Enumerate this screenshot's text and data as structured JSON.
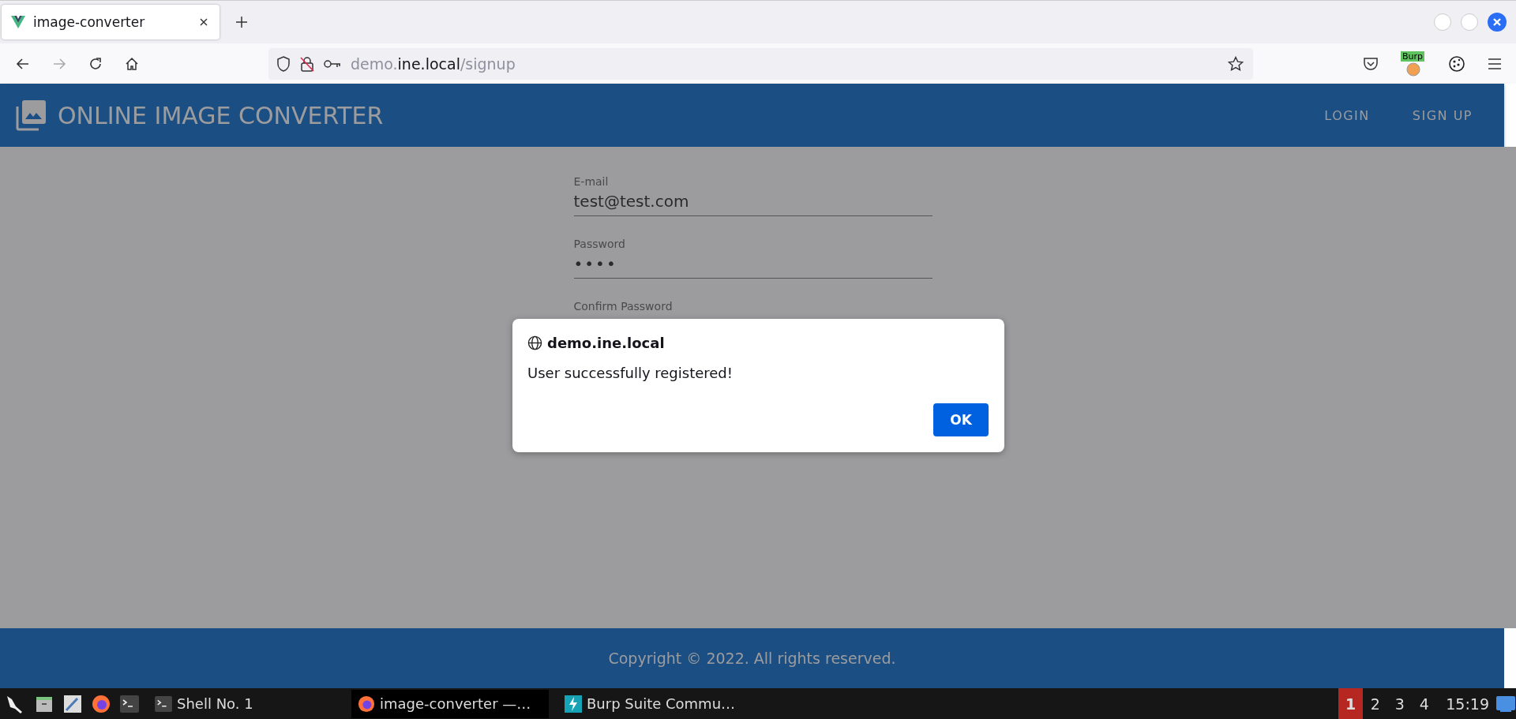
{
  "browser": {
    "tabs": [
      {
        "title": "image-converter",
        "selected": true
      }
    ],
    "url": {
      "prefix": "demo.",
      "domain": "ine.local",
      "path": "/signup"
    },
    "extension_badge": "Burp"
  },
  "app_header": {
    "title": "ONLINE IMAGE CONVERTER",
    "nav": [
      {
        "label": "LOGIN"
      },
      {
        "label": "SIGN UP"
      }
    ]
  },
  "form": {
    "fields": [
      {
        "label": "E-mail",
        "value": "test@test.com",
        "kind": "text"
      },
      {
        "label": "Password",
        "value": "••••",
        "kind": "password"
      },
      {
        "label": "Confirm Password"
      }
    ]
  },
  "dialog": {
    "origin": "demo.ine.local",
    "message": "User successfully registered!",
    "button": "OK"
  },
  "footer": {
    "text": "Copyright © 2022. All rights reserved."
  },
  "taskbar": {
    "windows": [
      {
        "label": "Shell No. 1",
        "kind": "terminal",
        "selected": false
      },
      {
        "label": "image-converter —…",
        "kind": "firefox",
        "selected": true
      },
      {
        "label": "Burp Suite Commu…",
        "kind": "burp",
        "selected": false
      }
    ],
    "workspaces": [
      {
        "label": "1",
        "selected": true
      },
      {
        "label": "2",
        "selected": false
      },
      {
        "label": "3",
        "selected": false
      },
      {
        "label": "4",
        "selected": false
      }
    ],
    "clock": "15:19"
  }
}
